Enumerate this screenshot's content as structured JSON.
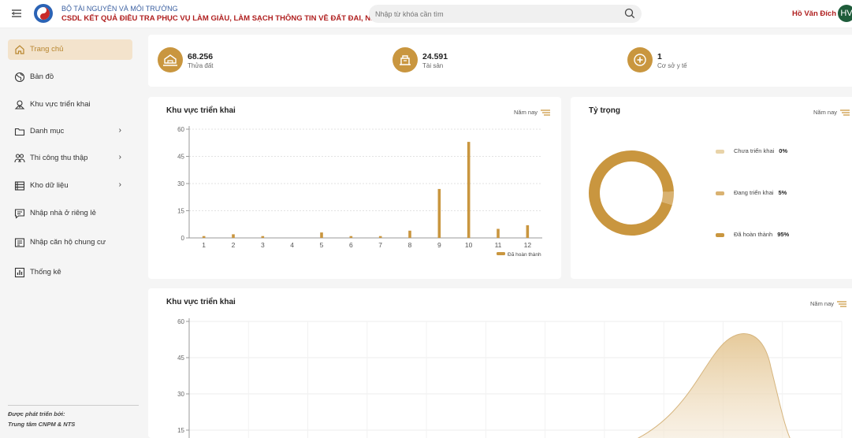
{
  "header": {
    "org_line1": "BỘ TÀI NGUYÊN VÀ MÔI TRƯỜNG",
    "org_line2": "CSDL KẾT QUẢ ĐIỀU TRA PHỤC VỤ LÀM GIÀU, LÀM SẠCH THÔNG TIN VỀ ĐẤT ĐAI, NHÀ Ở",
    "search_placeholder": "Nhập từ khóa cần tìm",
    "user_name": "Hồ Văn Đích",
    "avatar_initials": "HV",
    "accent_color": "#c9963f"
  },
  "sidebar": {
    "items": [
      {
        "label": "Trang chủ",
        "icon": "home-icon",
        "active": true,
        "has_children": false
      },
      {
        "label": "Bản đồ",
        "icon": "globe-icon",
        "active": false,
        "has_children": false
      },
      {
        "label": "Khu vực triển khai",
        "icon": "map-pin-icon",
        "active": false,
        "has_children": false
      },
      {
        "label": "Danh mục",
        "icon": "folder-icon",
        "active": false,
        "has_children": true
      },
      {
        "label": "Thi công thu thập",
        "icon": "people-icon",
        "active": false,
        "has_children": true
      },
      {
        "label": "Kho dữ liệu",
        "icon": "database-icon",
        "active": false,
        "has_children": true
      },
      {
        "label": "Nhập nhà ở riêng lẻ",
        "icon": "message-icon",
        "active": false,
        "has_children": false
      },
      {
        "label": "Nhập căn hộ chung cư",
        "icon": "document-icon",
        "active": false,
        "has_children": false
      },
      {
        "label": "Thống kê",
        "icon": "chart-icon",
        "active": false,
        "has_children": false
      }
    ],
    "footer_line1": "Được phát triển bởi:",
    "footer_line2": "Trung tâm CNPM & NTS"
  },
  "stats": [
    {
      "value": "68.256",
      "label": "Thửa đất",
      "icon": "land-icon"
    },
    {
      "value": "24.591",
      "label": "Tài sản",
      "icon": "asset-icon"
    },
    {
      "value": "1",
      "label": "Cơ sở y tế",
      "icon": "medical-icon"
    }
  ],
  "bar_card": {
    "title": "Khu vực triển khai",
    "filter": "Năm nay"
  },
  "donut_card": {
    "title": "Tỷ trọng",
    "filter": "Năm nay"
  },
  "area_card": {
    "title": "Khu vực triển khai",
    "filter": "Năm nay"
  },
  "chart_data": [
    {
      "type": "bar",
      "title": "Khu vực triển khai",
      "categories": [
        "1",
        "2",
        "3",
        "4",
        "5",
        "6",
        "7",
        "8",
        "9",
        "10",
        "11",
        "12"
      ],
      "series": [
        {
          "name": "Đã hoàn thành",
          "values": [
            1,
            2,
            1,
            0,
            3,
            1,
            1,
            4,
            27,
            53,
            5,
            7
          ],
          "color": "#c9963f"
        }
      ],
      "ylim": [
        0,
        60
      ],
      "yticks": [
        0,
        15,
        30,
        45,
        60
      ],
      "grid": true,
      "legend": "bottom-right"
    },
    {
      "type": "pie",
      "title": "Tỷ trọng",
      "labels": [
        "Chưa triển khai",
        "Đang triển khai",
        "Đã hoàn thành"
      ],
      "values": [
        0,
        5,
        95
      ],
      "value_labels": [
        "0%",
        "5%",
        "95%"
      ],
      "colors": [
        "#e8d3a8",
        "#d9b271",
        "#c9963f"
      ],
      "donut": true,
      "legend": "right"
    },
    {
      "type": "area",
      "title": "Khu vực triển khai",
      "ylim": [
        15,
        60
      ],
      "yticks": [
        15,
        30,
        45,
        60
      ],
      "grid": true
    }
  ]
}
